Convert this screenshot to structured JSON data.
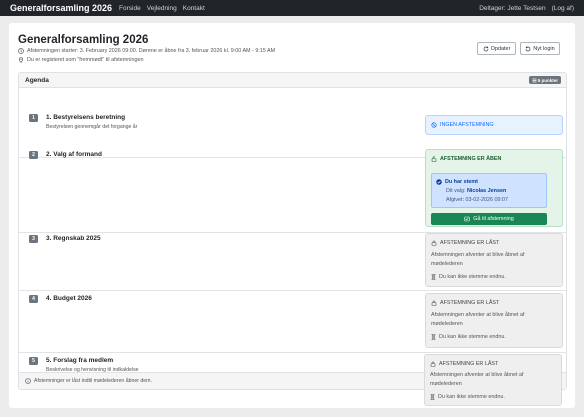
{
  "navbar": {
    "brand": "Generalforsamling 2026",
    "links": [
      "Forside",
      "Vejledning",
      "Kontakt"
    ],
    "participant": "Deltager: Jette Testsen",
    "logout": "(Log af)"
  },
  "header": {
    "title": "Generalforsamling 2026",
    "schedule": "Afstemningen starter: 3. February 2026 09:00. Dørene er åbne fra 3. februar 2026 kl. 9:00 AM - 9:15 AM",
    "registration": "Du er registeret som \"fremmødt\" til afstemningen",
    "refresh_label": "Opdater",
    "new_login_label": "Nyt login"
  },
  "agenda": {
    "title": "Agenda",
    "count_label": "5 punkter",
    "footer_note": "Afstemninger er låst indtil mødelederen åbner dem.",
    "items": [
      {
        "number": "1",
        "title": "1. Bestyrelsens beretning",
        "description": "Bestyrelsen gennemgår det forgange år",
        "status": {
          "type": "none",
          "label": "INGEN AFSTEMNING"
        }
      },
      {
        "number": "2",
        "title": "2. Valg af formand",
        "description": "",
        "status": {
          "type": "open",
          "label": "AFSTEMNING ER ÅBEN",
          "voted_title": "Du har stemt",
          "choice_prefix": "Dit valg:",
          "choice": "Nicolas Jensen",
          "cast": "Afgivet: 03-02-2026 09:07",
          "button": "Gå til afstemning"
        }
      },
      {
        "number": "3",
        "title": "3. Regnskab 2025",
        "description": "",
        "status": {
          "type": "locked",
          "label": "AFSTEMNING ER LÅST",
          "text": "Afstemningen afventer at blive åbnet af mødelederen",
          "note": "Du kan ikke stemme endnu."
        }
      },
      {
        "number": "4",
        "title": "4. Budget 2026",
        "description": "",
        "status": {
          "type": "locked",
          "label": "AFSTEMNING ER LÅST",
          "text": "Afstemningen afventer at blive åbnet af mødelederen",
          "note": "Du kan ikke stemme endnu."
        }
      },
      {
        "number": "5",
        "title": "5. Forslag fra medlem",
        "description": "Beskrivelse og henvisning til indkaldelse",
        "status": {
          "type": "locked",
          "label": "AFSTEMNING ER LÅST",
          "text": "Afstemningen afventer at blive åbnet af mødelederen",
          "note": "Du kan ikke stemme endnu."
        }
      }
    ]
  },
  "icons": {
    "clock": "clock-icon",
    "location": "location-icon",
    "refresh": "refresh-icon",
    "login": "login-icon",
    "list": "list-icon",
    "info": "info-icon",
    "no_vote": "ban-icon",
    "open": "unlock-icon",
    "locked": "lock-icon",
    "hourglass": "hourglass-icon",
    "check": "check-circle-icon",
    "go": "ballot-icon"
  },
  "colors": {
    "navbar": "#212529",
    "primary": "#0d6efd",
    "success": "#198754",
    "badge": "#6c757d"
  }
}
